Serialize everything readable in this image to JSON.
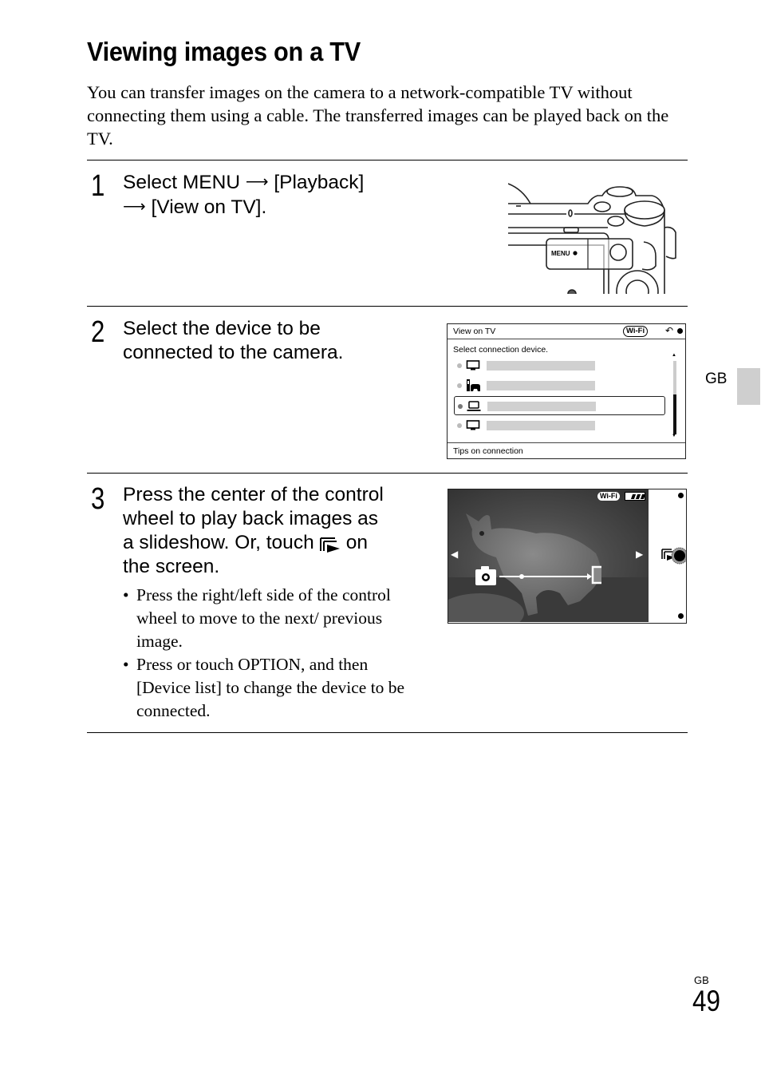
{
  "page": {
    "title": "Viewing images on a TV",
    "intro": "You can transfer images on the camera to a network-compatible TV without connecting them using a cable. The transferred images can be played back on the TV.",
    "side_tab": "GB",
    "footer_lang": "GB",
    "page_number": "49"
  },
  "steps": [
    {
      "number": "1",
      "lines": [
        "Select MENU",
        "[Playback]",
        "[View on TV]."
      ]
    },
    {
      "number": "2",
      "lines": [
        "Select the device to be",
        "connected to the camera."
      ]
    },
    {
      "number": "3",
      "lines": [
        "Press the center of the control",
        "wheel to play back images as",
        "a slideshow. Or, touch",
        "on",
        "the screen."
      ],
      "bullets": [
        "Press the right/left side of the control wheel to move to the next/ previous image.",
        "Press or touch OPTION, and then [Device list] to change the device to be connected."
      ]
    }
  ],
  "camera_illustration": {
    "button_label": "MENU"
  },
  "menu_screen": {
    "title": "View on TV",
    "wifi_label": "Wi-Fi",
    "back_icon": "return-icon",
    "prompt": "Select connection device.",
    "devices": [
      {
        "icon": "tv-icon",
        "selected": false
      },
      {
        "icon": "game-console-icon",
        "selected": false
      },
      {
        "icon": "laptop-icon",
        "selected": true
      },
      {
        "icon": "tv-icon",
        "selected": false
      }
    ],
    "scroll_position": 0.55,
    "footer": "Tips on connection"
  },
  "playback_screen": {
    "wifi_label": "Wi-Fi",
    "battery_level": "3/3",
    "left_arrow": "◀",
    "right_arrow": "▶"
  }
}
